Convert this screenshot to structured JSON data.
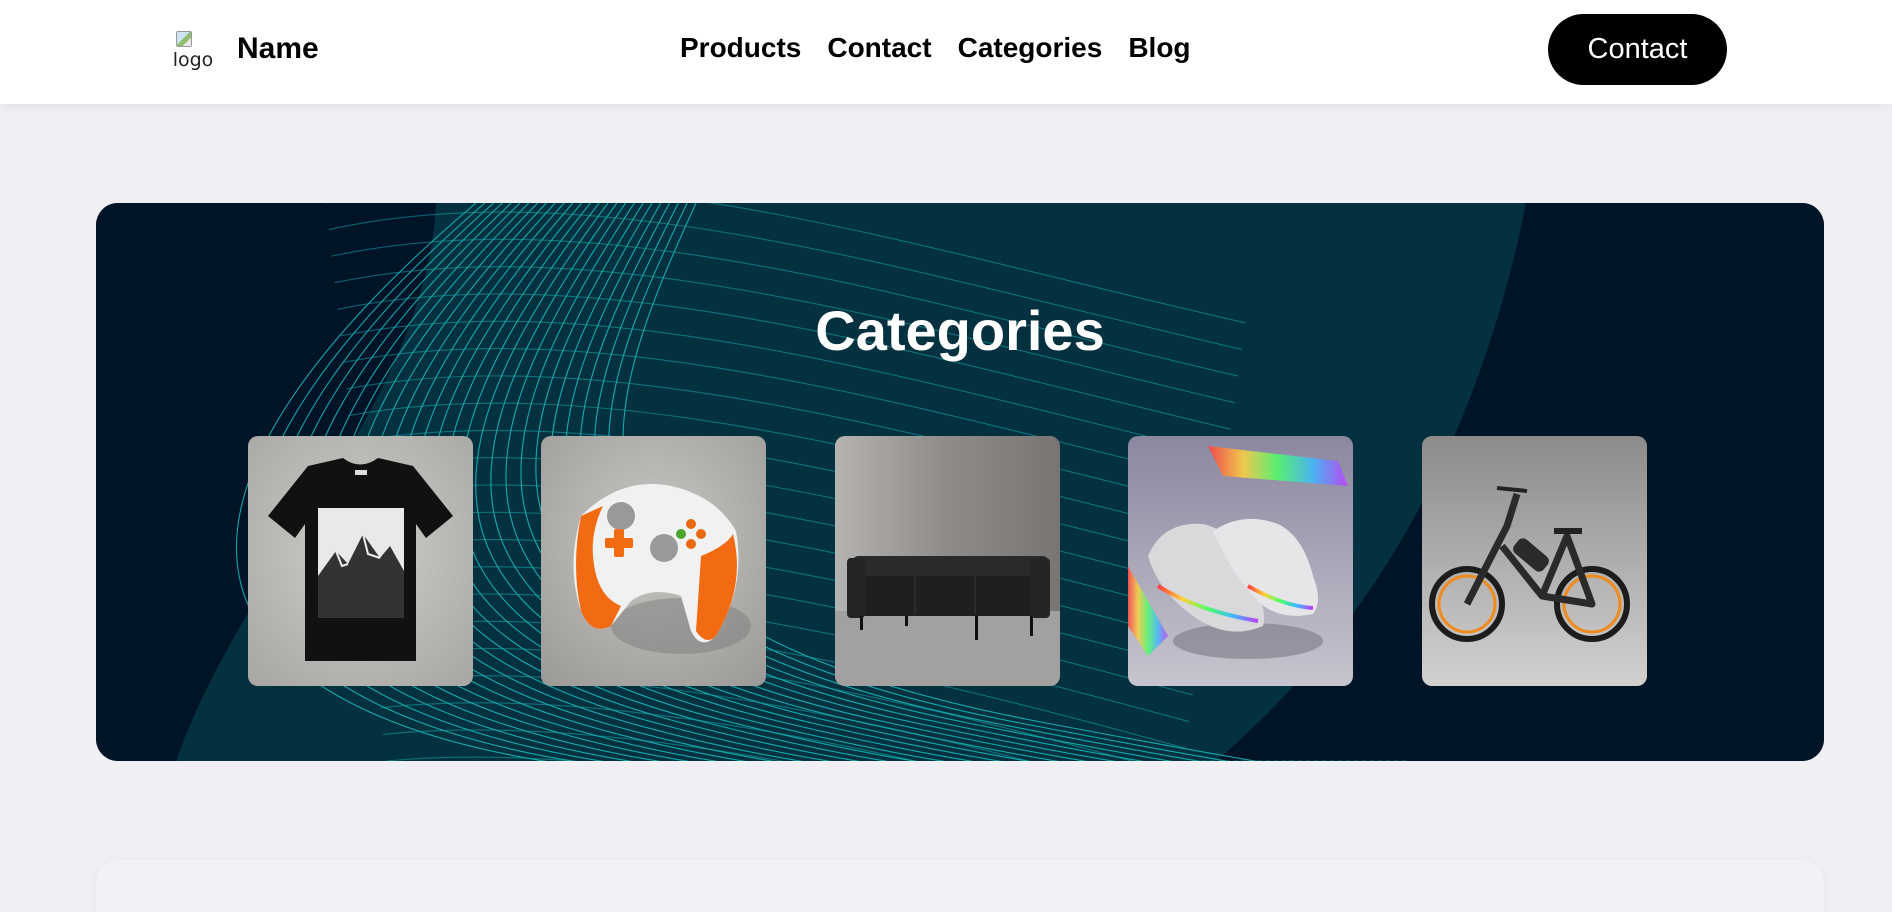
{
  "header": {
    "logo_alt": "logo",
    "brand_name": "Name",
    "nav": [
      "Products",
      "Contact",
      "Categories",
      "Blog"
    ],
    "cta_label": "Contact"
  },
  "hero": {
    "title": "Categories",
    "categories": [
      {
        "icon": "tshirt-image"
      },
      {
        "icon": "game-controller-image"
      },
      {
        "icon": "sofa-image"
      },
      {
        "icon": "sneakers-image"
      },
      {
        "icon": "ebike-image"
      }
    ]
  },
  "colors": {
    "hero_dark": "#001428",
    "hero_teal": "#04313f",
    "line_cyan": "#19d3d3",
    "button_black": "#000000",
    "page_bg": "#efeff4"
  }
}
